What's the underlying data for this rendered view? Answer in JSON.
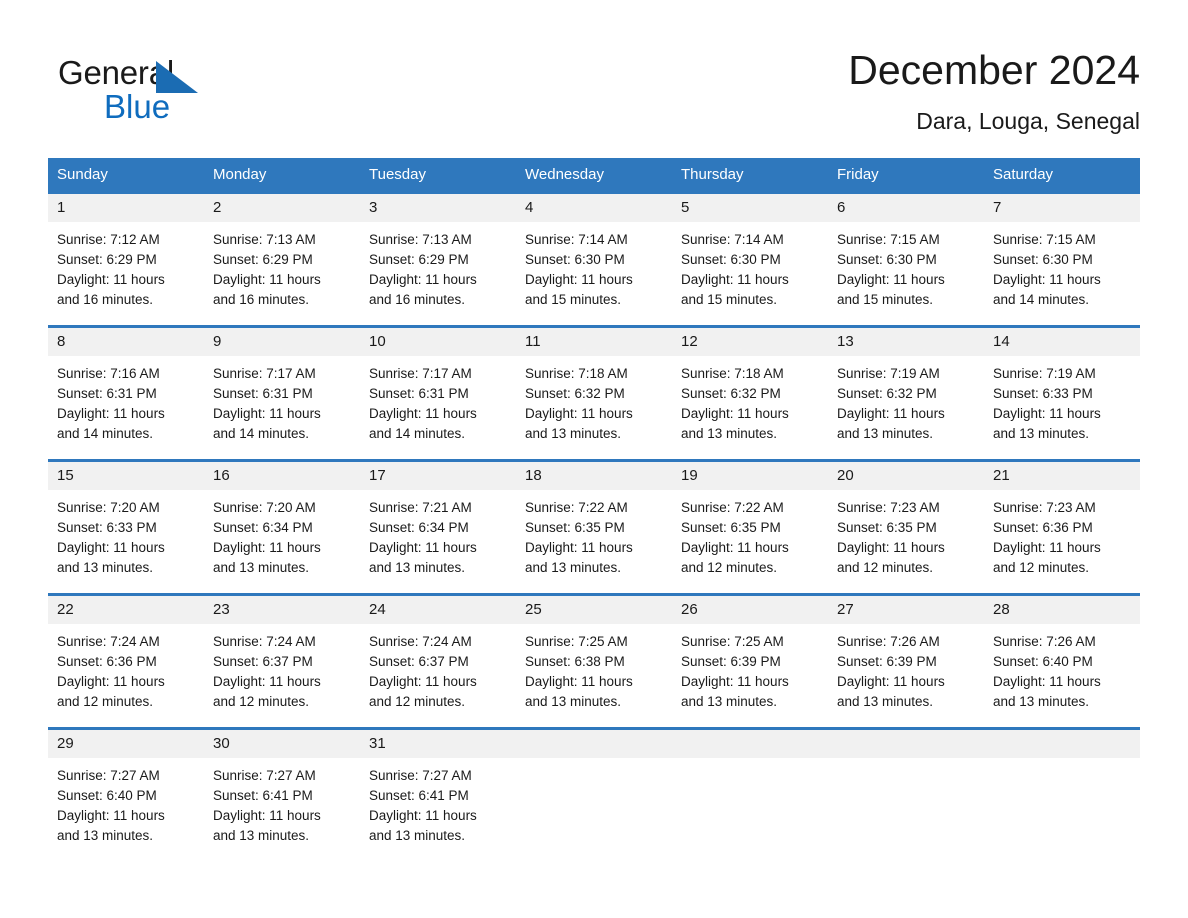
{
  "brand": {
    "name_part1": "General",
    "name_part2": "Blue",
    "triangle_color": "#1b6cb3",
    "blue_color": "#0f6cbe"
  },
  "header": {
    "title": "December 2024",
    "subtitle": "Dara, Louga, Senegal"
  },
  "theme": {
    "header_blue": "#2f78bd",
    "row_divider_blue": "#2f78bd",
    "daynum_background": "#f1f1f1"
  },
  "weekday_headers": [
    "Sunday",
    "Monday",
    "Tuesday",
    "Wednesday",
    "Thursday",
    "Friday",
    "Saturday"
  ],
  "labels": {
    "sunrise_prefix": "Sunrise:",
    "sunset_prefix": "Sunset:",
    "daylight_prefix": "Daylight:"
  },
  "weeks": [
    [
      {
        "day": "1",
        "line1": "Sunrise: 7:12 AM",
        "line2": "Sunset: 6:29 PM",
        "line3": "Daylight: 11 hours",
        "line4": "and 16 minutes."
      },
      {
        "day": "2",
        "line1": "Sunrise: 7:13 AM",
        "line2": "Sunset: 6:29 PM",
        "line3": "Daylight: 11 hours",
        "line4": "and 16 minutes."
      },
      {
        "day": "3",
        "line1": "Sunrise: 7:13 AM",
        "line2": "Sunset: 6:29 PM",
        "line3": "Daylight: 11 hours",
        "line4": "and 16 minutes."
      },
      {
        "day": "4",
        "line1": "Sunrise: 7:14 AM",
        "line2": "Sunset: 6:30 PM",
        "line3": "Daylight: 11 hours",
        "line4": "and 15 minutes."
      },
      {
        "day": "5",
        "line1": "Sunrise: 7:14 AM",
        "line2": "Sunset: 6:30 PM",
        "line3": "Daylight: 11 hours",
        "line4": "and 15 minutes."
      },
      {
        "day": "6",
        "line1": "Sunrise: 7:15 AM",
        "line2": "Sunset: 6:30 PM",
        "line3": "Daylight: 11 hours",
        "line4": "and 15 minutes."
      },
      {
        "day": "7",
        "line1": "Sunrise: 7:15 AM",
        "line2": "Sunset: 6:30 PM",
        "line3": "Daylight: 11 hours",
        "line4": "and 14 minutes."
      }
    ],
    [
      {
        "day": "8",
        "line1": "Sunrise: 7:16 AM",
        "line2": "Sunset: 6:31 PM",
        "line3": "Daylight: 11 hours",
        "line4": "and 14 minutes."
      },
      {
        "day": "9",
        "line1": "Sunrise: 7:17 AM",
        "line2": "Sunset: 6:31 PM",
        "line3": "Daylight: 11 hours",
        "line4": "and 14 minutes."
      },
      {
        "day": "10",
        "line1": "Sunrise: 7:17 AM",
        "line2": "Sunset: 6:31 PM",
        "line3": "Daylight: 11 hours",
        "line4": "and 14 minutes."
      },
      {
        "day": "11",
        "line1": "Sunrise: 7:18 AM",
        "line2": "Sunset: 6:32 PM",
        "line3": "Daylight: 11 hours",
        "line4": "and 13 minutes."
      },
      {
        "day": "12",
        "line1": "Sunrise: 7:18 AM",
        "line2": "Sunset: 6:32 PM",
        "line3": "Daylight: 11 hours",
        "line4": "and 13 minutes."
      },
      {
        "day": "13",
        "line1": "Sunrise: 7:19 AM",
        "line2": "Sunset: 6:32 PM",
        "line3": "Daylight: 11 hours",
        "line4": "and 13 minutes."
      },
      {
        "day": "14",
        "line1": "Sunrise: 7:19 AM",
        "line2": "Sunset: 6:33 PM",
        "line3": "Daylight: 11 hours",
        "line4": "and 13 minutes."
      }
    ],
    [
      {
        "day": "15",
        "line1": "Sunrise: 7:20 AM",
        "line2": "Sunset: 6:33 PM",
        "line3": "Daylight: 11 hours",
        "line4": "and 13 minutes."
      },
      {
        "day": "16",
        "line1": "Sunrise: 7:20 AM",
        "line2": "Sunset: 6:34 PM",
        "line3": "Daylight: 11 hours",
        "line4": "and 13 minutes."
      },
      {
        "day": "17",
        "line1": "Sunrise: 7:21 AM",
        "line2": "Sunset: 6:34 PM",
        "line3": "Daylight: 11 hours",
        "line4": "and 13 minutes."
      },
      {
        "day": "18",
        "line1": "Sunrise: 7:22 AM",
        "line2": "Sunset: 6:35 PM",
        "line3": "Daylight: 11 hours",
        "line4": "and 13 minutes."
      },
      {
        "day": "19",
        "line1": "Sunrise: 7:22 AM",
        "line2": "Sunset: 6:35 PM",
        "line3": "Daylight: 11 hours",
        "line4": "and 12 minutes."
      },
      {
        "day": "20",
        "line1": "Sunrise: 7:23 AM",
        "line2": "Sunset: 6:35 PM",
        "line3": "Daylight: 11 hours",
        "line4": "and 12 minutes."
      },
      {
        "day": "21",
        "line1": "Sunrise: 7:23 AM",
        "line2": "Sunset: 6:36 PM",
        "line3": "Daylight: 11 hours",
        "line4": "and 12 minutes."
      }
    ],
    [
      {
        "day": "22",
        "line1": "Sunrise: 7:24 AM",
        "line2": "Sunset: 6:36 PM",
        "line3": "Daylight: 11 hours",
        "line4": "and 12 minutes."
      },
      {
        "day": "23",
        "line1": "Sunrise: 7:24 AM",
        "line2": "Sunset: 6:37 PM",
        "line3": "Daylight: 11 hours",
        "line4": "and 12 minutes."
      },
      {
        "day": "24",
        "line1": "Sunrise: 7:24 AM",
        "line2": "Sunset: 6:37 PM",
        "line3": "Daylight: 11 hours",
        "line4": "and 12 minutes."
      },
      {
        "day": "25",
        "line1": "Sunrise: 7:25 AM",
        "line2": "Sunset: 6:38 PM",
        "line3": "Daylight: 11 hours",
        "line4": "and 13 minutes."
      },
      {
        "day": "26",
        "line1": "Sunrise: 7:25 AM",
        "line2": "Sunset: 6:39 PM",
        "line3": "Daylight: 11 hours",
        "line4": "and 13 minutes."
      },
      {
        "day": "27",
        "line1": "Sunrise: 7:26 AM",
        "line2": "Sunset: 6:39 PM",
        "line3": "Daylight: 11 hours",
        "line4": "and 13 minutes."
      },
      {
        "day": "28",
        "line1": "Sunrise: 7:26 AM",
        "line2": "Sunset: 6:40 PM",
        "line3": "Daylight: 11 hours",
        "line4": "and 13 minutes."
      }
    ],
    [
      {
        "day": "29",
        "line1": "Sunrise: 7:27 AM",
        "line2": "Sunset: 6:40 PM",
        "line3": "Daylight: 11 hours",
        "line4": "and 13 minutes."
      },
      {
        "day": "30",
        "line1": "Sunrise: 7:27 AM",
        "line2": "Sunset: 6:41 PM",
        "line3": "Daylight: 11 hours",
        "line4": "and 13 minutes."
      },
      {
        "day": "31",
        "line1": "Sunrise: 7:27 AM",
        "line2": "Sunset: 6:41 PM",
        "line3": "Daylight: 11 hours",
        "line4": "and 13 minutes."
      },
      {
        "day": "",
        "line1": "",
        "line2": "",
        "line3": "",
        "line4": ""
      },
      {
        "day": "",
        "line1": "",
        "line2": "",
        "line3": "",
        "line4": ""
      },
      {
        "day": "",
        "line1": "",
        "line2": "",
        "line3": "",
        "line4": ""
      },
      {
        "day": "",
        "line1": "",
        "line2": "",
        "line3": "",
        "line4": ""
      }
    ]
  ]
}
